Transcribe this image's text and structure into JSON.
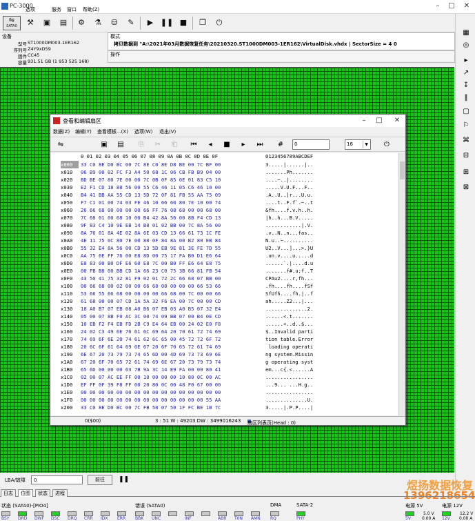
{
  "window": {
    "title": "PC-3000"
  },
  "menu": [
    "选项",
    "服务",
    "窗口",
    "帮助(Z)"
  ],
  "toolbar": {
    "sata_label": "SATA0"
  },
  "device": {
    "label": "设备",
    "rows": [
      {
        "k": "型号",
        "v": "ST1000DM003-1ER162"
      },
      {
        "k": "序列号",
        "v": "Z4Y9xD59"
      },
      {
        "k": "固件",
        "v": "CC45"
      },
      {
        "k": "容量",
        "v": "931.51 GB (1 953 525 168)"
      }
    ]
  },
  "mode": {
    "label": "模式",
    "text": "拷贝数据到 \"A:\\2021年03月数据恢复任务\\20210320.ST1000DM003-1ER162\\VirtualDisk.vhdx | SectorSize = 4 0"
  },
  "ops": {
    "label": "操作"
  },
  "editor": {
    "title": "查看和编辑扇区",
    "menu": [
      "数据(Z)",
      "编辑(Y)",
      "查看模板...(X)",
      "选项(W)",
      "退出(V)"
    ],
    "search_value": "0",
    "radix_value": "16",
    "header_hex": "0 01 02 03 04 05 06 07 08 09 0A 0B 0C 0D 0E 0F",
    "header_ascii": "0123456789ABCDEF",
    "rows": [
      {
        "a": "x000",
        "h": "33 C0 8E D0 BC 00 7C 8E C0 8E D8 BE 00 7C BF 00",
        "s": "3.....|......|.."
      },
      {
        "a": "x010",
        "h": "06 B9 00 02 FC F3 A4 50 68 1C 06 CB FB B9 04 00",
        "s": ".......Ph......."
      },
      {
        "a": "x020",
        "h": "BD BE 07 80 7E 00 00 7C 0B 0F 85 0E 01 83 C5 10",
        "s": "....~..|........"
      },
      {
        "a": "x030",
        "h": "E2 F1 CD 18 88 56 00 55 C6 46 11 05 C6 46 10 00",
        "s": ".....V.U.F...F.."
      },
      {
        "a": "x040",
        "h": "B4 41 BB AA 55 CD 13 5D 72 0F 81 FB 55 AA 75 09",
        "s": ".A..U..]r...U.u."
      },
      {
        "a": "x050",
        "h": "F7 C1 01 00 74 03 FE 46 10 66 60 80 7E 10 00 74",
        "s": "....t..F.f`.~..t"
      },
      {
        "a": "x060",
        "h": "26 66 68 00 00 00 00 66 FF 76 08 68 00 00 68 00",
        "s": "&fh....f.v.h..h."
      },
      {
        "a": "x070",
        "h": "7C 68 01 00 68 10 00 B4 42 8A 56 00 8B F4 CD 13",
        "s": "|h..h...B.V....."
      },
      {
        "a": "x080",
        "h": "9F 83 C4 10 9E EB 14 B8 01 02 BB 00 7C 8A 56 00",
        "s": "............|.V."
      },
      {
        "a": "x090",
        "h": "8A 76 01 8A 4E 02 8A 6E 03 CD 13 66 61 73 1C FE",
        "s": ".v..N..n...fas.."
      },
      {
        "a": "x0A0",
        "h": "4E 11 75 0C 80 7E 00 80 0F 84 8A 00 B2 80 EB 84",
        "s": "N.u..~.........."
      },
      {
        "a": "x0B0",
        "h": "55 32 E4 8A 56 00 CD 13 5D EB 9E 81 3E FE 7D 55",
        "s": "U2..V...]...>.}U"
      },
      {
        "a": "x0C0",
        "h": "AA 75 6E FF 76 00 E8 8D 00 75 17 FA B0 D1 E6 64",
        "s": ".un.v....u.....d"
      },
      {
        "a": "x0D0",
        "h": "E8 83 00 B0 DF E6 60 E8 7C 00 B0 FF E6 64 E8 75",
        "s": "......`.|....d.u"
      },
      {
        "a": "x0E0",
        "h": "00 FB B8 00 BB CD 1A 66 23 C0 75 3B 66 81 FB 54",
        "s": ".......f#.u;f..T"
      },
      {
        "a": "x0F0",
        "h": "43 50 41 75 32 81 F9 02 01 72 2C 66 68 07 BB 00",
        "s": "CPAu2....r,fh..."
      },
      {
        "a": "x100",
        "h": "00 66 68 00 02 00 00 66 68 08 00 00 00 66 53 66",
        "s": ".fh....fh....fSf"
      },
      {
        "a": "x110",
        "h": "53 66 55 66 68 00 00 00 00 66 68 00 7C 00 00 66",
        "s": "SfUfh....fh.|..f"
      },
      {
        "a": "x120",
        "h": "61 68 00 00 07 CD 1A 5A 32 F6 EA 00 7C 00 00 CD",
        "s": "ah.....Z2...|..."
      },
      {
        "a": "x130",
        "h": "18 A0 B7 07 EB 08 A0 B6 07 EB 03 A0 B5 07 32 E4",
        "s": "..............2."
      },
      {
        "a": "x140",
        "h": "05 00 07 8B F0 AC 3C 00 74 09 BB 07 00 B4 0E CD",
        "s": "......<.t......."
      },
      {
        "a": "x150",
        "h": "10 EB F2 F4 EB FD 2B C9 E4 64 EB 00 24 02 E0 F8",
        "s": "......+..d..$..."
      },
      {
        "a": "x160",
        "h": "24 02 C3 49 6E 76 61 6C 69 64 20 70 61 72 74 69",
        "s": "$..Invalid parti"
      },
      {
        "a": "x170",
        "h": "74 69 6F 6E 20 74 61 62 6C 65 00 45 72 72 6F 72",
        "s": "tion table.Error"
      },
      {
        "a": "x180",
        "h": "20 6C 6F 61 64 69 6E 67 20 6F 70 65 72 61 74 69",
        "s": " loading operati"
      },
      {
        "a": "x190",
        "h": "6E 67 20 73 79 73 74 65 6D 00 4D 69 73 73 69 6E",
        "s": "ng system.Missin"
      },
      {
        "a": "x1A0",
        "h": "67 20 6F 70 65 72 61 74 69 6E 67 20 73 79 73 74",
        "s": "g operating syst"
      },
      {
        "a": "x1B0",
        "h": "65 6D 00 00 00 63 7B 9A 3C 14 E9 FA 00 00 80 41",
        "s": "em...c{.<......A"
      },
      {
        "a": "x1C0",
        "h": "02 00 07 AC EE FF 00 10 00 00 00 10 80 0C 00 AC",
        "s": "................"
      },
      {
        "a": "x1D0",
        "h": "EF FF 0F 39 F8 FF 00 20 80 0C 00 48 F0 67 00 00",
        "s": "...9... ...H.g.."
      },
      {
        "a": "x1E0",
        "h": "00 00 00 00 00 00 00 00 00 00 00 00 00 00 00 00",
        "s": "................"
      },
      {
        "a": "x1F0",
        "h": "00 00 00 00 00 00 00 00 00 00 00 00 00 00 55 AA",
        "s": "..............U."
      },
      {
        "a": "x200",
        "h": "33 C0 8E D0 BC 00 7C FB 50 07 50 1F FC BE 1B 7C",
        "s": "3.....|.P.P....|"
      }
    ],
    "status": {
      "sector": "0($00)",
      "pos": "3 : 51 W : 49203 DW : 3499016243",
      "region": "扇区列表页(Head : 0)"
    }
  },
  "lba": {
    "label": "LBA/故障",
    "value": "0",
    "go": "前往"
  },
  "tabs": [
    "日志",
    "位图",
    "状态",
    "进程"
  ],
  "statusbar": {
    "groups": [
      {
        "title": "状态 (SATA0)-[PIO4]",
        "leds": [
          {
            "l": "BSY",
            "on": false
          },
          {
            "l": "DRD",
            "on": true
          },
          {
            "l": "DWF",
            "on": false
          },
          {
            "l": "DSC",
            "on": true
          },
          {
            "l": "DRQ",
            "on": false
          },
          {
            "l": "CRR",
            "on": false
          },
          {
            "l": "IDX",
            "on": false
          },
          {
            "l": "ERR",
            "on": false
          }
        ]
      },
      {
        "title": "错误 (SATA0)",
        "leds": [
          {
            "l": "BBK",
            "on": false
          },
          {
            "l": "UNC",
            "on": false
          },
          {
            "l": "",
            "on": false
          },
          {
            "l": "INF",
            "on": false
          },
          {
            "l": "",
            "on": false
          },
          {
            "l": "ABR",
            "on": false
          },
          {
            "l": "T0N",
            "on": false
          },
          {
            "l": "AMN",
            "on": false
          }
        ]
      },
      {
        "title": "DMA",
        "leds": [
          {
            "l": "RQ",
            "on": false
          }
        ]
      },
      {
        "title": "SATA-2",
        "leds": [
          {
            "l": "PHY",
            "on": true
          }
        ]
      },
      {
        "title": "电源 5V",
        "leds": [
          {
            "l": "5V",
            "on": true
          }
        ]
      },
      {
        "title": "电源 12V",
        "leds": [
          {
            "l": "12V",
            "on": true
          }
        ]
      }
    ],
    "v5": "5.0 V",
    "a5": "0.00 A",
    "v12": "12.2 V",
    "a12": "0.00 A"
  },
  "watermark": {
    "line1": "煜扬数据恢复",
    "line2": "13962186546"
  },
  "colors": {
    "grid_green": "#18c418",
    "hex_blue": "#2323a0"
  }
}
